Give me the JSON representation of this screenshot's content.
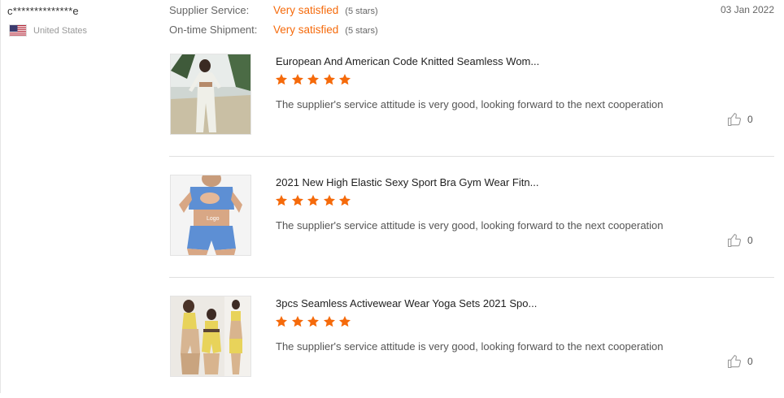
{
  "reviewer": {
    "name": "c**************e",
    "country": "United States",
    "flag_icon": "us-flag-icon"
  },
  "ratings": [
    {
      "label": "Supplier Service:",
      "value": "Very satisfied",
      "stars": "(5 stars)"
    },
    {
      "label": "On-time Shipment:",
      "value": "Very satisfied",
      "stars": "(5 stars)"
    }
  ],
  "date": "03 Jan 2022",
  "accent_color": "#f56a0b",
  "items": [
    {
      "title": "European And American Code Knitted Seamless Wom...",
      "rating": 5,
      "comment": "The supplier's service attitude is very good, looking forward to the next cooperation",
      "likes": "0",
      "like_icon": "thumbs-up-icon"
    },
    {
      "title": "2021 New High Elastic Sexy Sport Bra Gym Wear Fitn...",
      "rating": 5,
      "comment": "The supplier's service attitude is very good, looking forward to the next cooperation",
      "likes": "0",
      "like_icon": "thumbs-up-icon",
      "image_text": "Logo"
    },
    {
      "title": "3pcs Seamless Activewear Wear Yoga Sets 2021 Spo...",
      "rating": 5,
      "comment": "The supplier's service attitude is very good, looking forward to the next cooperation",
      "likes": "0",
      "like_icon": "thumbs-up-icon"
    }
  ]
}
